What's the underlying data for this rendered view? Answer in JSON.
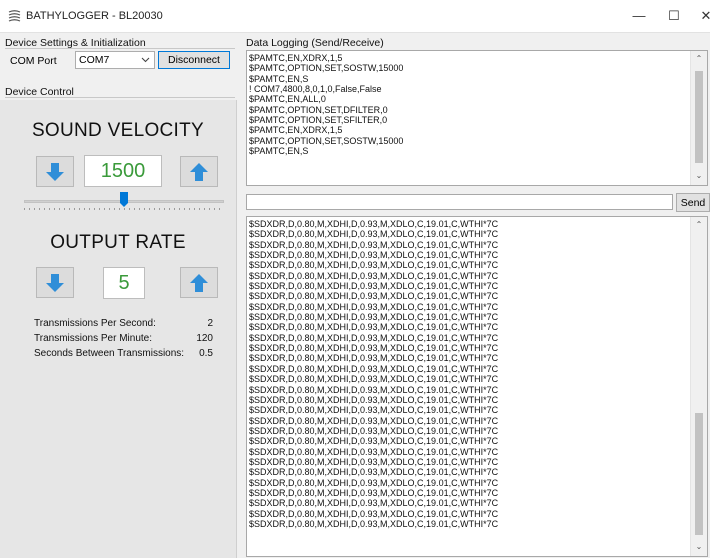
{
  "window": {
    "title": "BATHYLOGGER - BL20030",
    "minimize": "—",
    "maximize": "☐",
    "close": "✕"
  },
  "device_settings": {
    "group_label": "Device Settings & Initialization",
    "com_port_label": "COM Port",
    "com_port_value": "COM7",
    "disconnect_label": "Disconnect"
  },
  "device_control": {
    "group_label": "Device Control",
    "sound_velocity_title": "SOUND VELOCITY",
    "sound_velocity_value": "1500",
    "slider_level": 0.5,
    "output_rate_title": "OUTPUT RATE",
    "output_rate_value": "5",
    "stats": [
      {
        "label": "Transmissions Per Second:",
        "value": "2"
      },
      {
        "label": "Transmissions Per Minute:",
        "value": "120"
      },
      {
        "label": "Seconds Between Transmissions:",
        "value": "0.5"
      }
    ]
  },
  "data_logging": {
    "group_label": "Data Logging (Send/Receive)",
    "sent_lines": [
      "$PAMTC,EN,XDRX,1,5",
      "$PAMTC,OPTION,SET,SOSTW,15000",
      "$PAMTC,EN,S",
      "! COM7,4800,8,0,1,0,False,False",
      "$PAMTC,EN,ALL,0",
      "$PAMTC,OPTION,SET,DFILTER,0",
      "$PAMTC,OPTION,SET,SFILTER,0",
      "$PAMTC,EN,XDRX,1,5",
      "$PAMTC,OPTION,SET,SOSTW,15000",
      "$PAMTC,EN,S"
    ],
    "send_input_value": "",
    "send_label": "Send",
    "received_line": "$SDXDR,D,0.80,M,XDHI,D,0.93,M,XDLO,C,19.01,C,WTHI*7C",
    "received_line_count": 30
  }
}
